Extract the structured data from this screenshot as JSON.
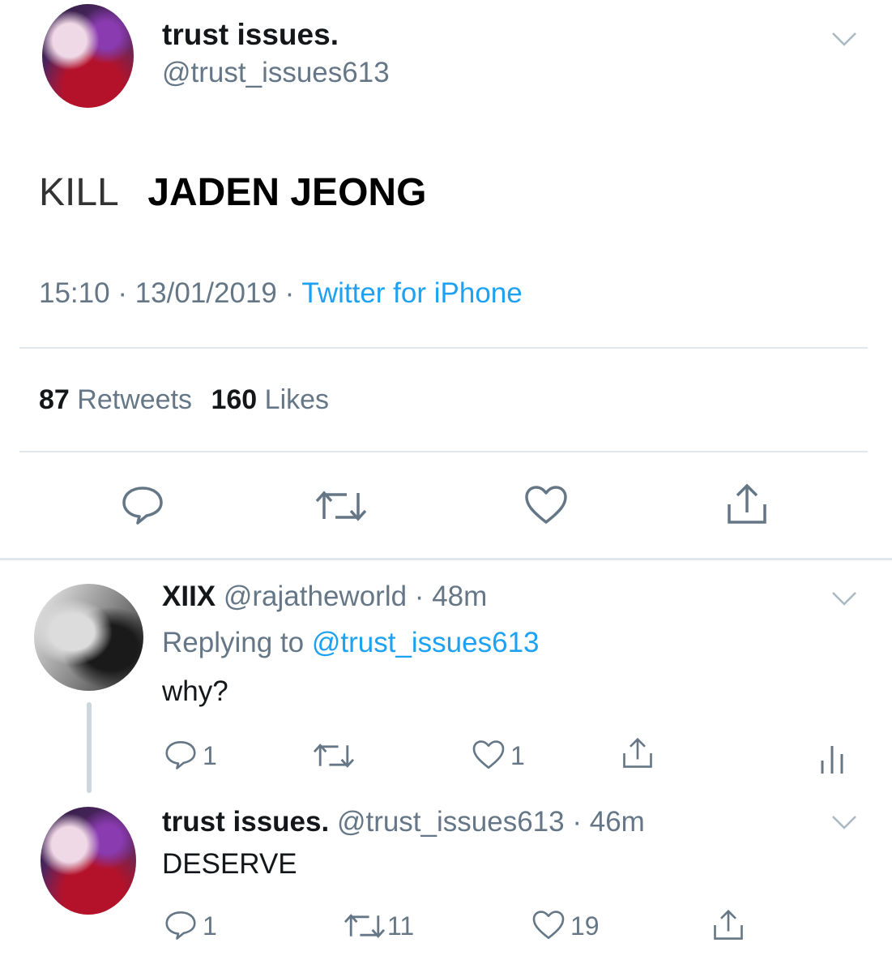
{
  "main_tweet": {
    "display_name": "trust issues.",
    "handle": "@trust_issues613",
    "text_part1": "KILL",
    "text_part2": "JADEN JEONG",
    "time": "15:10",
    "date": "13/01/2019",
    "source": "Twitter for iPhone",
    "retweet_count": "87",
    "retweet_label": "Retweets",
    "like_count": "160",
    "like_label": "Likes"
  },
  "reply1": {
    "display_name": "XIIX",
    "handle": "@rajatheworld",
    "time": "48m",
    "replying_label": "Replying to",
    "replying_handle": "@trust_issues613",
    "text": "why?",
    "reply_count": "1",
    "like_count": "1"
  },
  "reply2": {
    "display_name": "trust issues.",
    "handle": "@trust_issues613",
    "time": "46m",
    "text": "DESERVE",
    "reply_count": "1",
    "retweet_count": "11",
    "like_count": "19"
  },
  "separator": "·",
  "colors": {
    "link": "#1da1f2",
    "muted": "#657786",
    "divider": "#e1e8ed"
  }
}
